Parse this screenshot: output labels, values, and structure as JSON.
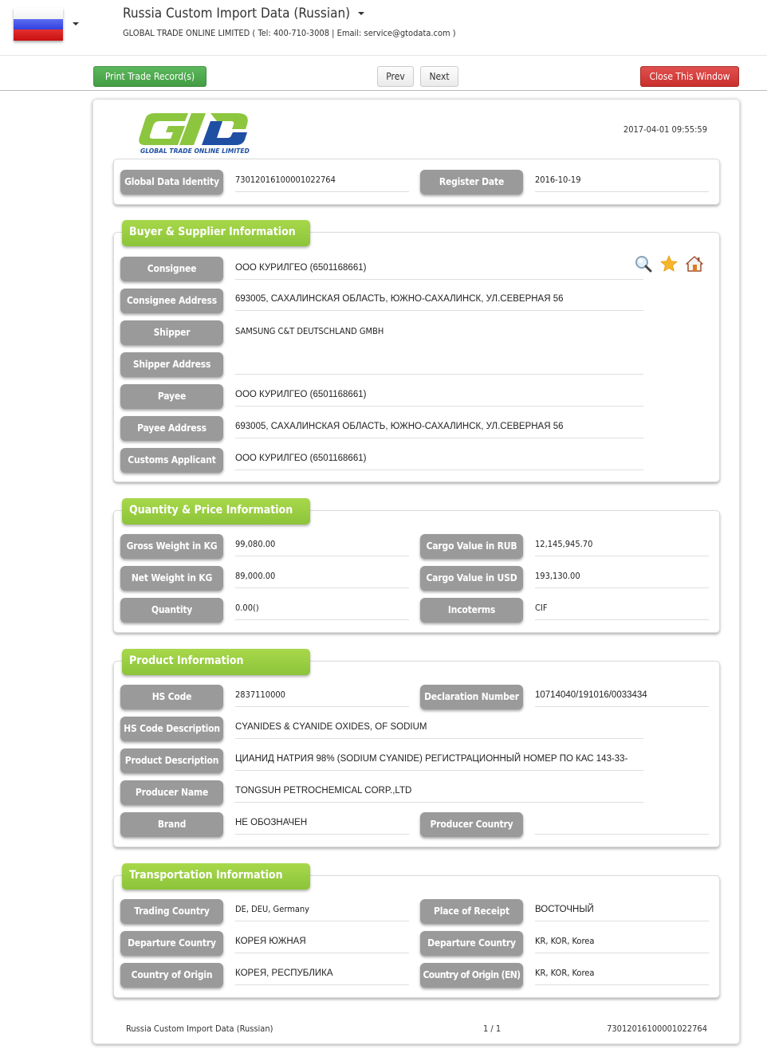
{
  "header": {
    "country_flag": "russia-flag",
    "title": "Russia Custom Import Data (Russian)",
    "subtitle": "GLOBAL TRADE ONLINE LIMITED ( Tel: 400-710-3008 | Email: service@gtodata.com )"
  },
  "toolbar": {
    "print_label": "Print Trade Record(s)",
    "prev_label": "Prev",
    "next_label": "Next",
    "close_label": "Close This Window"
  },
  "record": {
    "logo_text": "GLOBAL TRADE ONLINE LIMITED",
    "timestamp": "2017-04-01 09:55:59",
    "identity": {
      "global_data_identity_label": "Global Data Identity",
      "global_data_identity": "73012016100001022764",
      "register_date_label": "Register Date",
      "register_date": "2016-10-19"
    },
    "buyer_supplier": {
      "title": "Buyer & Supplier Information",
      "icons": [
        "search-icon",
        "star-icon",
        "home-icon"
      ],
      "rows": [
        {
          "label": "Consignee",
          "value": "ООО КУРИЛГЕО (6501168661)"
        },
        {
          "label": "Consignee Address",
          "value": "693005, САХАЛИНСКАЯ ОБЛАСТЬ, ЮЖНО-САХАЛИНСК, УЛ.СЕВЕРНАЯ 56"
        },
        {
          "label": "Shipper",
          "value": "SAMSUNG C&T DEUTSCHLAND GMBH"
        },
        {
          "label": "Shipper Address",
          "value": ""
        },
        {
          "label": "Payee",
          "value": "ООО КУРИЛГЕО  (6501168661)"
        },
        {
          "label": "Payee Address",
          "value": "693005, САХАЛИНСКАЯ ОБЛАСТЬ, ЮЖНО-САХАЛИНСК, УЛ.СЕВЕРНАЯ 56"
        },
        {
          "label": "Customs Applicant",
          "value": "ООО КУРИЛГЕО  (6501168661)"
        }
      ]
    },
    "quantity_price": {
      "title": "Quantity & Price Information",
      "rows": [
        {
          "label": "Gross Weight in KG",
          "value": "99,080.00",
          "label2": "Cargo Value in RUB",
          "value2": "12,145,945.70"
        },
        {
          "label": "Net Weight in KG",
          "value": "89,000.00",
          "label2": "Cargo Value in USD",
          "value2": "193,130.00"
        },
        {
          "label": "Quantity",
          "value": "0.00()",
          "label2": "Incoterms",
          "value2": "CIF"
        }
      ]
    },
    "product": {
      "title": "Product Information",
      "hs_code_label": "HS Code",
      "hs_code": "2837110000",
      "declaration_number_label": "Declaration Number",
      "declaration_number": "10714040/191016/0033434",
      "hs_code_description_label": "HS Code Description",
      "hs_code_description": "CYANIDES & CYANIDE OXIDES, OF SODIUM",
      "product_description_label": "Product Description",
      "product_description": "ЦИАНИД НАТРИЯ 98% (SODIUM CYANIDE) РЕГИСТРАЦИОННЫЙ НОМЕР ПО КАС 143-33-",
      "producer_name_label": "Producer Name",
      "producer_name": "TONGSUH PETROCHEMICAL CORP.,LTD",
      "brand_label": "Brand",
      "brand": "НЕ ОБОЗНАЧЕН",
      "producer_country_label": "Producer Country",
      "producer_country": ""
    },
    "transportation": {
      "title": "Transportation Information",
      "rows": [
        {
          "label": "Trading Country",
          "value": "DE, DEU, Germany",
          "label2": "Place of Receipt",
          "value2": "ВОСТОЧНЫЙ"
        },
        {
          "label": "Departure Country",
          "value": "КОРЕЯ ЮЖНАЯ",
          "label2": "Departure Country",
          "value2": "KR, KOR, Korea"
        },
        {
          "label": "Country of Origin",
          "value": "КОРЕЯ, РЕСПУБЛИКА",
          "label2": "Country of Origin (EN)",
          "value2": "KR, KOR, Korea"
        }
      ]
    },
    "footer": {
      "source": "Russia Custom Import Data (Russian)",
      "page": "1 / 1",
      "identity": "73012016100001022764"
    }
  }
}
